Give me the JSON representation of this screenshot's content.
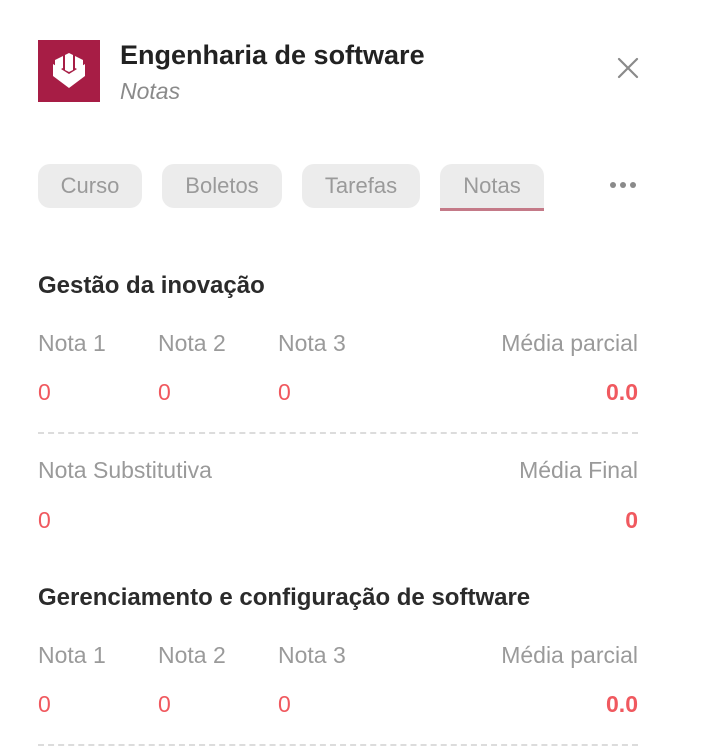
{
  "header": {
    "title": "Engenharia de software",
    "subtitle": "Notas",
    "logo_icon": "book-shield-icon",
    "brand_color": "#a71d45"
  },
  "tabs": [
    {
      "label": "Curso",
      "active": false
    },
    {
      "label": "Boletos",
      "active": false
    },
    {
      "label": "Tarefas",
      "active": false
    },
    {
      "label": "Notas",
      "active": true
    }
  ],
  "subjects": [
    {
      "name": "Gestão da inovação",
      "labels": {
        "n1": "Nota 1",
        "n2": "Nota 2",
        "n3": "Nota 3",
        "partial": "Média parcial",
        "sub": "Nota Substitutiva",
        "final": "Média Final"
      },
      "values": {
        "n1": "0",
        "n2": "0",
        "n3": "0",
        "partial": "0.0",
        "sub": "0",
        "final": "0"
      }
    },
    {
      "name": "Gerenciamento e configuração de software",
      "labels": {
        "n1": "Nota 1",
        "n2": "Nota 2",
        "n3": "Nota 3",
        "partial": "Média parcial"
      },
      "values": {
        "n1": "0",
        "n2": "0",
        "n3": "0",
        "partial": "0.0"
      }
    }
  ],
  "colors": {
    "value": "#f0595f",
    "label": "#9a9a9a",
    "active_tab_underline": "#c47a88"
  }
}
